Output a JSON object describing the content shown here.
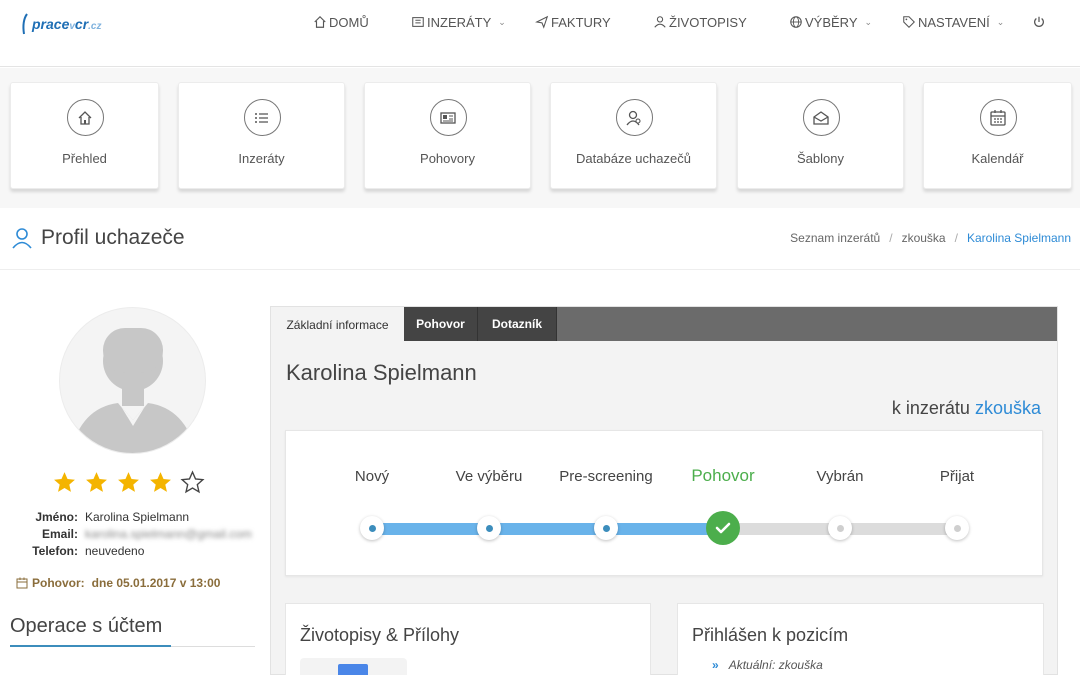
{
  "logo": {
    "prace": "prace",
    "v": "v",
    "cr": "cr",
    "tld": ".cz"
  },
  "nav": [
    {
      "label": "DOMŮ",
      "icon": "home-icon"
    },
    {
      "label": "INZERÁTY",
      "icon": "newspaper-icon",
      "dropdown": true
    },
    {
      "label": "FAKTURY",
      "icon": "paper-plane-icon"
    },
    {
      "label": "ŽIVOTOPISY",
      "icon": "user-icon"
    },
    {
      "label": "VÝBĚRY",
      "icon": "globe-icon",
      "dropdown": true
    },
    {
      "label": "NASTAVENÍ",
      "icon": "tag-icon",
      "dropdown": true
    },
    {
      "label": "",
      "icon": "power-icon"
    }
  ],
  "tiles": [
    {
      "label": "Přehled",
      "icon": "home-icon"
    },
    {
      "label": "Inzeráty",
      "icon": "list-icon"
    },
    {
      "label": "Pohovory",
      "icon": "newspaper-icon"
    },
    {
      "label": "Databáze uchazečů",
      "icon": "user-search-icon"
    },
    {
      "label": "Šablony",
      "icon": "envelope-icon"
    },
    {
      "label": "Kalendář",
      "icon": "calendar-icon"
    }
  ],
  "page": {
    "title": "Profil uchazeče",
    "breadcrumbs": [
      "Seznam inzerátů",
      "zkouška",
      "Karolina Spielmann"
    ]
  },
  "candidate": {
    "rating": 4,
    "rating_max": 5,
    "name_label": "Jméno:",
    "name": "Karolina Spielmann",
    "email_label": "Email:",
    "email": "karolina.spielmann@gmail.com",
    "phone_label": "Telefon:",
    "phone": "neuvedeno",
    "interview_label": "Pohovor:",
    "interview_value": "dne 05.01.2017 v 13:00"
  },
  "account_ops_title": "Operace s účtem",
  "tabs": [
    "Základní informace",
    "Pohovor",
    "Dotazník"
  ],
  "main": {
    "name": "Karolina Spielmann",
    "for_ad_prefix": "k inzerátu",
    "for_ad_link": "zkouška"
  },
  "stages": {
    "items": [
      "Nový",
      "Ve výběru",
      "Pre-screening",
      "Pohovor",
      "Vybrán",
      "Přijat"
    ],
    "current": 3
  },
  "colors": {
    "accent": "#2e8bd6",
    "progress": "#69b3ea",
    "done": "#4cae4c",
    "star": "#f4b400"
  },
  "cards": {
    "cv_title": "Životopisy & Přílohy",
    "positions_title": "Přihlášen k pozicím",
    "position_item": "Aktuální: zkouška"
  }
}
